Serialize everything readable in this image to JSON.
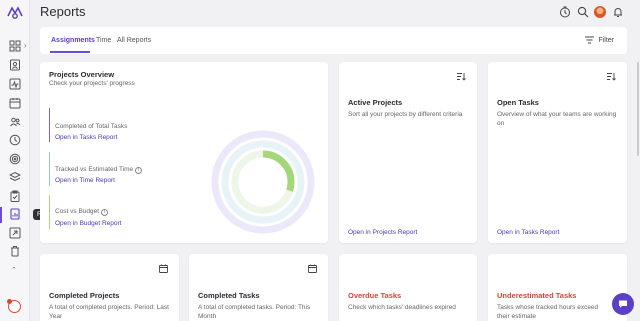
{
  "header": {
    "title": "Reports"
  },
  "tabs": [
    {
      "label": "Assignments"
    },
    {
      "label": "Time"
    },
    {
      "label": "All Reports"
    }
  ],
  "filter": {
    "label": "Filter"
  },
  "sidebar": {
    "tooltip": "Reports"
  },
  "overview": {
    "title": "Projects Overview",
    "subtitle": "Check your projects' progress",
    "metrics": [
      {
        "label": "Completed of Total Tasks",
        "link": "Open in Tasks Report",
        "color": "#7a63d8"
      },
      {
        "label": "Tracked vs Estimated Time",
        "link": "Open in Time Report",
        "color": "#8fc9d6"
      },
      {
        "label": "Cost vs Budget",
        "link": "Open in Budget Report",
        "color": "#a8d77e"
      }
    ],
    "donut": {
      "completed_fraction": 0.3,
      "colors": {
        "outer": "#e6e3f8",
        "middle": "#e2f2f6",
        "inner": "#a4d67a"
      }
    }
  },
  "active_projects": {
    "title": "Active Projects",
    "description": "Sort all your projects by different criteria",
    "link": "Open in Projects Report"
  },
  "open_tasks": {
    "title": "Open Tasks",
    "description": "Overview of what your teams are working on",
    "link": "Open in Tasks Report"
  },
  "completed_projects": {
    "title": "Completed Projects",
    "description": "A total of completed projects. Period: Last Year"
  },
  "completed_tasks": {
    "title": "Completed Tasks",
    "description": "A total of completed tasks. Period: This Month"
  },
  "overdue_tasks": {
    "title": "Overdue Tasks",
    "description": "Check which tasks' deadlines expired"
  },
  "underestimated_tasks": {
    "title": "Underestimated Tasks",
    "description": "Tasks whose tracked hours exceed their estimate"
  },
  "colors": {
    "accent": "#5b3fc7",
    "danger": "#d2453a"
  }
}
